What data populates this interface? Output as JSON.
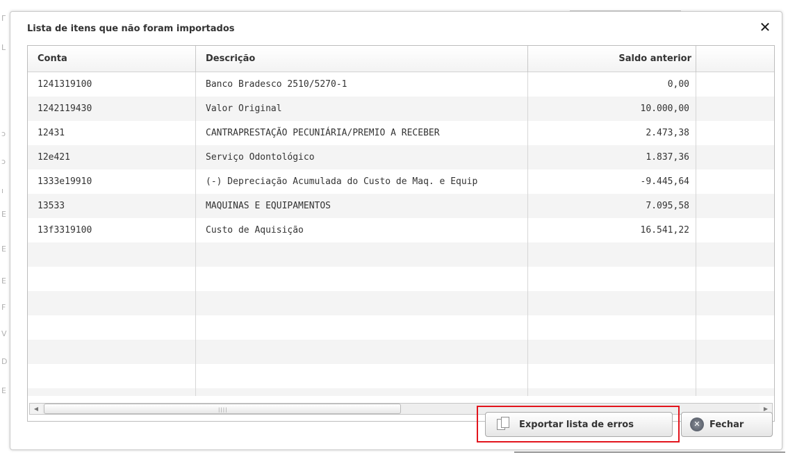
{
  "dialog": {
    "title": "Lista de itens que não foram importados",
    "close_glyph": "✕"
  },
  "grid": {
    "columns": [
      {
        "label": "Conta"
      },
      {
        "label": "Descrição"
      },
      {
        "label": "Saldo anterior"
      }
    ],
    "rows": [
      {
        "conta": "1241319100",
        "descricao": "Banco Bradesco 2510/5270-1",
        "saldo": "0,00"
      },
      {
        "conta": "1242119430",
        "descricao": "Valor Original",
        "saldo": "10.000,00"
      },
      {
        "conta": "12431",
        "descricao": "CANTRAPRESTAÇÃO PECUNIÁRIA/PREMIO A RECEBER",
        "saldo": "2.473,38"
      },
      {
        "conta": "12e421",
        "descricao": "Serviço Odontológico",
        "saldo": "1.837,36"
      },
      {
        "conta": "1333e19910",
        "descricao": "(-) Depreciação Acumulada do Custo de Maq. e Equip",
        "saldo": "-9.445,64"
      },
      {
        "conta": "13533",
        "descricao": "MAQUINAS E EQUIPAMENTOS",
        "saldo": "7.095,58"
      },
      {
        "conta": "13f3319100",
        "descricao": "Custo de Aquisição",
        "saldo": "16.541,22"
      }
    ],
    "scroll_left_glyph": "◀",
    "scroll_right_glyph": "▶",
    "scroll_grip": "||||"
  },
  "buttons": {
    "export_label": "Exportar lista de erros",
    "close_label": "Fechar",
    "close_icon_glyph": "✕"
  },
  "colors": {
    "highlight": "#e2141c",
    "row_alt": "#f4f4f4"
  }
}
